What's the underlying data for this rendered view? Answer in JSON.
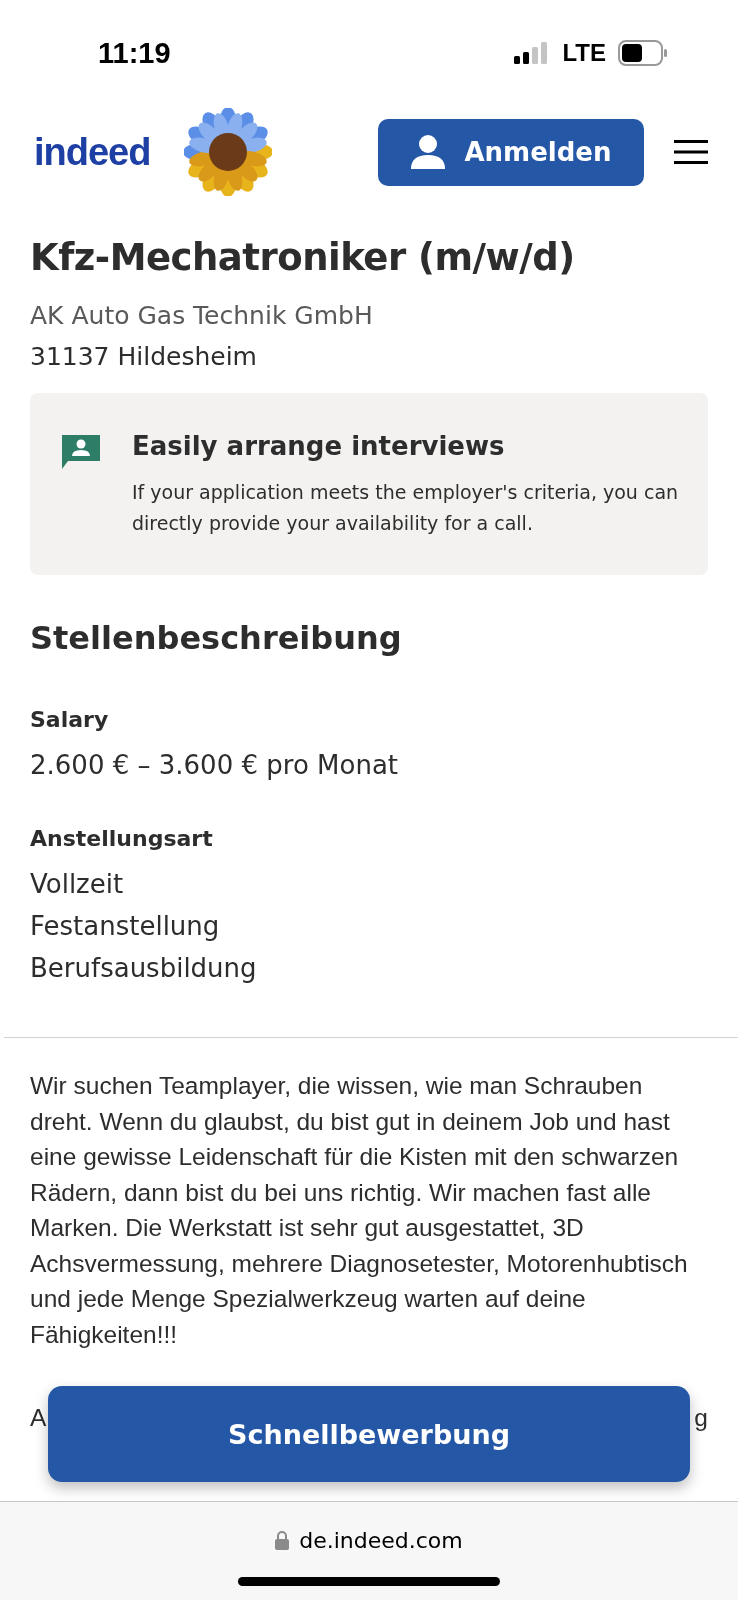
{
  "status_bar": {
    "time": "11:19",
    "network": "LTE"
  },
  "header": {
    "logo": "indeed",
    "login_button": "Anmelden"
  },
  "job": {
    "title": "Kfz-Mechatroniker (m/w/d)",
    "company": "AK Auto Gas Technik GmbH",
    "location": "31137 Hildesheim"
  },
  "notice": {
    "title": "Easily arrange interviews",
    "text": "If your application meets the employer's criteria, you can directly provide your availability for a call."
  },
  "description": {
    "heading": "Stellenbeschreibung",
    "sections": [
      {
        "label": "Salary",
        "values": [
          "2.600 € – 3.600 € pro Monat"
        ]
      },
      {
        "label": "Anstellungsart",
        "values": [
          "Vollzeit",
          "Festanstellung",
          "Berufsausbildung"
        ]
      }
    ],
    "paragraph": "Wir suchen Teamplayer, die wissen, wie man Schrauben dreht. Wenn du glaubst, du bist gut in deinem Job und hast eine gewisse Leidenschaft für die Kisten mit den schwarzen Rädern, dann bist du bei uns richtig. Wir machen fast alle Marken. Die Werkstatt ist sehr gut ausgestattet, 3D Achsvermessung, mehrere Diagnosetester, Motorenhubtisch und jede Menge Spezialwerkzeug warten auf deine Fähigkeiten!!!",
    "covered_line_start": "A",
    "covered_line_end": "g"
  },
  "apply_button": "Schnellbewerbung",
  "browser": {
    "url": "de.indeed.com"
  }
}
